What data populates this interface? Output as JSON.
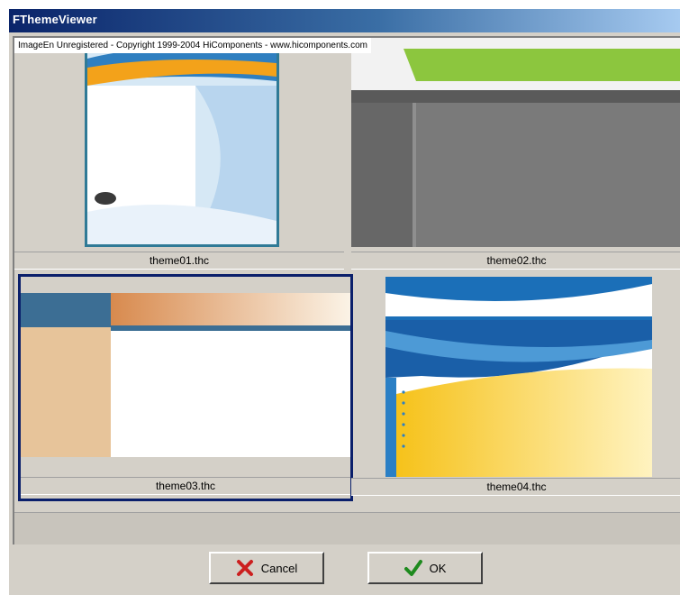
{
  "window": {
    "title": "FThemeViewer"
  },
  "watermark": "ImageEn Unregistered - Copyright 1999-2004 HiComponents - www.hicomponents.com",
  "thumbnails": [
    {
      "caption": "theme01.thc"
    },
    {
      "caption": "theme02.thc"
    },
    {
      "caption": "theme03.thc"
    },
    {
      "caption": "theme04.thc"
    }
  ],
  "selected_thumbnail": "theme03.thc",
  "buttons": {
    "cancel": "Cancel",
    "ok": "OK"
  },
  "icons": {
    "cancel": "red-x-icon",
    "ok": "green-check-icon"
  },
  "colors": {
    "title_bar_start": "#0a246a",
    "selection_border": "#0a1f6b",
    "cancel_icon": "#cc1f1f",
    "ok_icon": "#1e8a1e"
  }
}
